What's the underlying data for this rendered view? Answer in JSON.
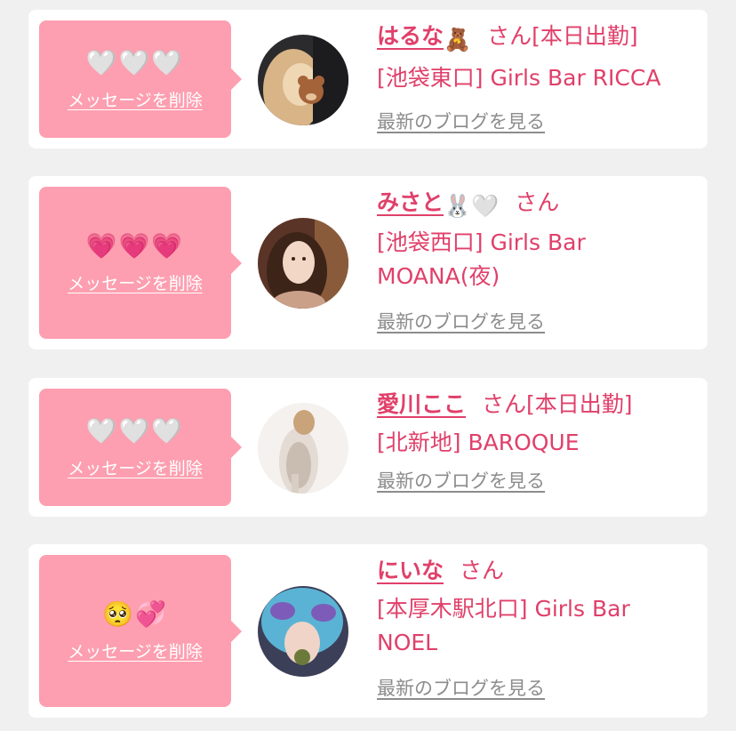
{
  "cards": [
    {
      "reaction": "🤍🤍🤍",
      "delete_label": "メッセージを削除",
      "name": "はるな",
      "name_emoji": "🧸",
      "san_suffix": "さん",
      "status": "[本日出勤]",
      "shop": "[池袋東口] Girls Bar RICCA",
      "blog_label": "最新のブログを見る",
      "avatar_colors": [
        "#2b2a2c",
        "#d8b487",
        "#efd7b4"
      ]
    },
    {
      "reaction": "💗💗💗",
      "delete_label": "メッセージを削除",
      "name": "みさと",
      "name_emoji": "🐰🤍",
      "san_suffix": "さん",
      "status": "",
      "shop": "[池袋西口] Girls Bar MOANA(夜)",
      "blog_label": "最新のブログを見る",
      "avatar_colors": [
        "#5a3426",
        "#caa089",
        "#f2d7c6"
      ]
    },
    {
      "reaction": "🤍🤍🤍",
      "delete_label": "メッセージを削除",
      "name": "愛川ここ",
      "name_emoji": "",
      "san_suffix": "さん",
      "status": "[本日出勤]",
      "shop": "[北新地] BAROQUE",
      "blog_label": "最新のブログを見る",
      "avatar_colors": [
        "#f4f1ee",
        "#e3dbd4",
        "#c9bcb0"
      ]
    },
    {
      "reaction": "🥺💞",
      "delete_label": "メッセージを削除",
      "name": "にいな",
      "name_emoji": "",
      "san_suffix": "さん",
      "status": "",
      "shop": "[本厚木駅北口] Girls Bar NOEL",
      "blog_label": "最新のブログを見る",
      "avatar_colors": [
        "#3b3f58",
        "#5ab3d4",
        "#7c5cb8"
      ]
    }
  ]
}
